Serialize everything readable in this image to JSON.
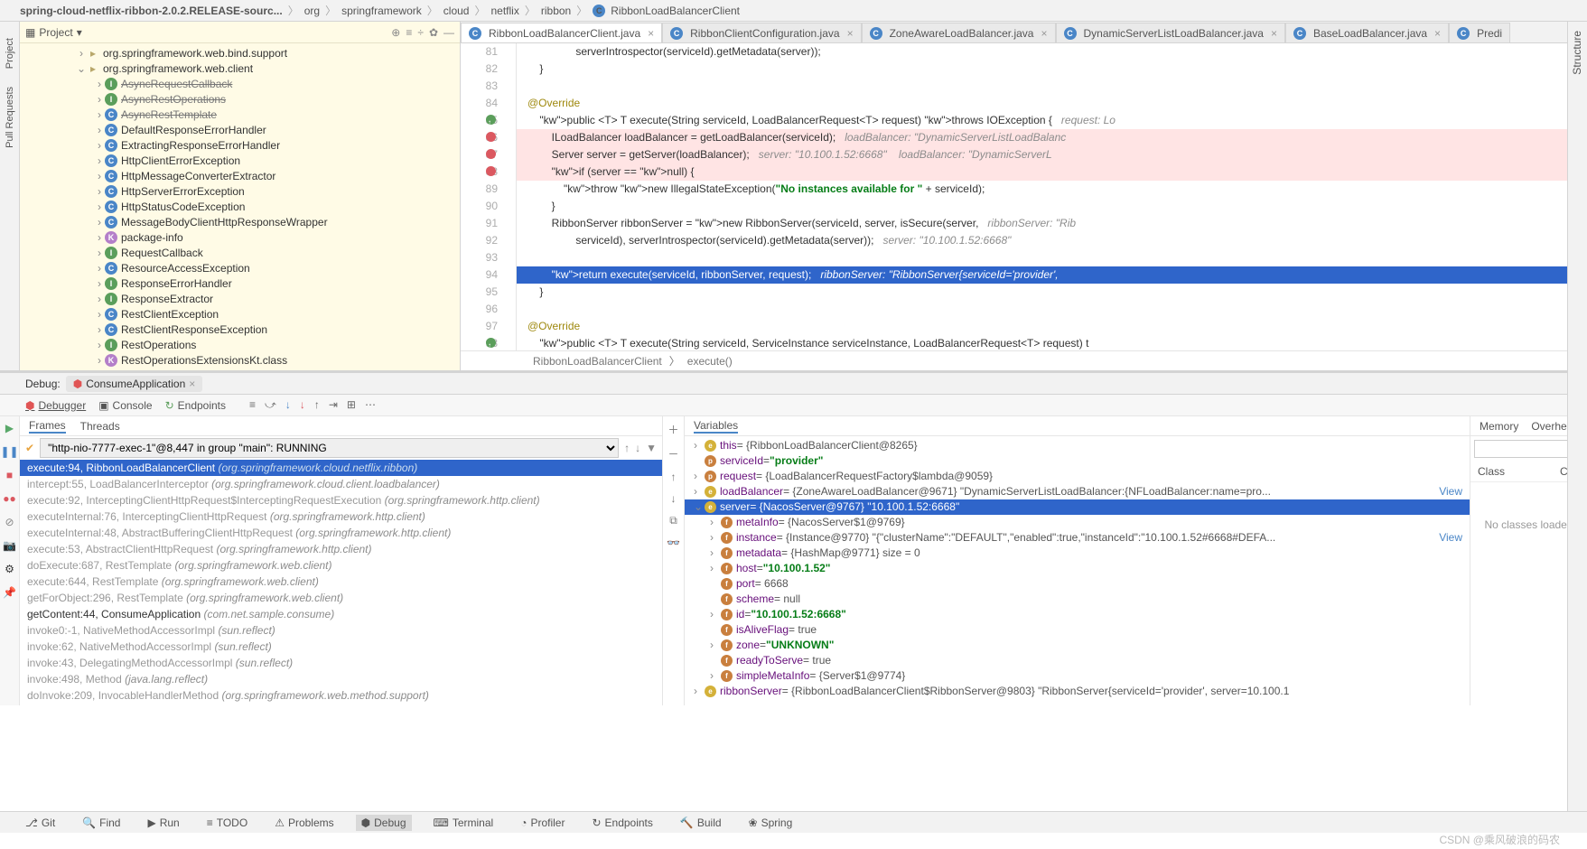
{
  "breadcrumbs": [
    "spring-cloud-netflix-ribbon-2.0.2.RELEASE-sourc...",
    "org",
    "springframework",
    "cloud",
    "netflix",
    "ribbon",
    "RibbonLoadBalancerClient"
  ],
  "project_label": "Project",
  "tree": {
    "pkg1": "org.springframework.web.bind.support",
    "pkg2": "org.springframework.web.client",
    "items": [
      {
        "t": "I",
        "n": "AsyncRequestCallback",
        "strike": true
      },
      {
        "t": "I",
        "n": "AsyncRestOperations",
        "strike": true
      },
      {
        "t": "C",
        "n": "AsyncRestTemplate",
        "strike": true
      },
      {
        "t": "C",
        "n": "DefaultResponseErrorHandler"
      },
      {
        "t": "C",
        "n": "ExtractingResponseErrorHandler"
      },
      {
        "t": "C",
        "n": "HttpClientErrorException"
      },
      {
        "t": "C",
        "n": "HttpMessageConverterExtractor"
      },
      {
        "t": "C",
        "n": "HttpServerErrorException"
      },
      {
        "t": "C",
        "n": "HttpStatusCodeException"
      },
      {
        "t": "C",
        "n": "MessageBodyClientHttpResponseWrapper"
      },
      {
        "t": "K",
        "n": "package-info"
      },
      {
        "t": "I",
        "n": "RequestCallback"
      },
      {
        "t": "C",
        "n": "ResourceAccessException"
      },
      {
        "t": "I",
        "n": "ResponseErrorHandler"
      },
      {
        "t": "I",
        "n": "ResponseExtractor"
      },
      {
        "t": "C",
        "n": "RestClientException"
      },
      {
        "t": "C",
        "n": "RestClientResponseException"
      },
      {
        "t": "I",
        "n": "RestOperations"
      },
      {
        "t": "K",
        "n": "RestOperationsExtensionsKt.class"
      }
    ]
  },
  "tabs": [
    "RibbonLoadBalancerClient.java",
    "RibbonClientConfiguration.java",
    "ZoneAwareLoadBalancer.java",
    "DynamicServerListLoadBalancer.java",
    "BaseLoadBalancer.java",
    "Predi"
  ],
  "code": {
    "lines": [
      {
        "n": 81,
        "t": "                serverIntrospector(serviceId).getMetadata(server));"
      },
      {
        "n": 82,
        "t": "    }"
      },
      {
        "n": 83,
        "t": ""
      },
      {
        "n": 84,
        "t": "    @Override",
        "ann": true
      },
      {
        "n": 85,
        "t": "    public <T> T execute(String serviceId, LoadBalancerRequest<T> request) throws IOException {",
        "cmt": "   request: Lo",
        "ov": true
      },
      {
        "n": 86,
        "t": "        ILoadBalancer loadBalancer = getLoadBalancer(serviceId);",
        "cmt": "   loadBalancer: \"DynamicServerListLoadBalanc",
        "bp": true,
        "hl": true
      },
      {
        "n": 87,
        "t": "        Server server = getServer(loadBalancer);",
        "cmt": "   server: \"10.100.1.52:6668\"    loadBalancer: \"DynamicServerL",
        "bp": true,
        "hl": true
      },
      {
        "n": 88,
        "t": "        if (server == null) {",
        "bp": true,
        "hl": true
      },
      {
        "n": 89,
        "t": "            throw new IllegalStateException(\"No instances available for \" + serviceId);"
      },
      {
        "n": 90,
        "t": "        }"
      },
      {
        "n": 91,
        "t": "        RibbonServer ribbonServer = new RibbonServer(serviceId, server, isSecure(server,",
        "cmt": "   ribbonServer: \"Rib"
      },
      {
        "n": 92,
        "t": "                serviceId), serverIntrospector(serviceId).getMetadata(server));",
        "cmt": "   server: \"10.100.1.52:6668\""
      },
      {
        "n": 93,
        "t": ""
      },
      {
        "n": 94,
        "t": "        return execute(serviceId, ribbonServer, request);",
        "cmt": "   ribbonServer: \"RibbonServer{serviceId='provider',",
        "cur": true
      },
      {
        "n": 95,
        "t": "    }"
      },
      {
        "n": 96,
        "t": ""
      },
      {
        "n": 97,
        "t": "    @Override",
        "ann": true
      },
      {
        "n": 98,
        "t": "    public <T> T execute(String serviceId, ServiceInstance serviceInstance, LoadBalancerRequest<T> request) t",
        "ov": true
      }
    ]
  },
  "crumb2": {
    "a": "RibbonLoadBalancerClient",
    "b": "execute()"
  },
  "debug": {
    "title": "Debug:",
    "app": "ConsumeApplication",
    "tabs": [
      "Debugger",
      "Console",
      "Endpoints"
    ],
    "subtabs": [
      "Frames",
      "Threads"
    ],
    "thread": "\"http-nio-7777-exec-1\"@8,447 in group \"main\": RUNNING",
    "frames": [
      {
        "m": "execute:94, RibbonLoadBalancerClient",
        "p": "(org.springframework.cloud.netflix.ribbon)",
        "sel": true
      },
      {
        "m": "intercept:55, LoadBalancerInterceptor",
        "p": "(org.springframework.cloud.client.loadbalancer)",
        "dim": true
      },
      {
        "m": "execute:92, InterceptingClientHttpRequest$InterceptingRequestExecution",
        "p": "(org.springframework.http.client)",
        "dim": true
      },
      {
        "m": "executeInternal:76, InterceptingClientHttpRequest",
        "p": "(org.springframework.http.client)",
        "dim": true
      },
      {
        "m": "executeInternal:48, AbstractBufferingClientHttpRequest",
        "p": "(org.springframework.http.client)",
        "dim": true
      },
      {
        "m": "execute:53, AbstractClientHttpRequest",
        "p": "(org.springframework.http.client)",
        "dim": true
      },
      {
        "m": "doExecute:687, RestTemplate",
        "p": "(org.springframework.web.client)",
        "dim": true
      },
      {
        "m": "execute:644, RestTemplate",
        "p": "(org.springframework.web.client)",
        "dim": true
      },
      {
        "m": "getForObject:296, RestTemplate",
        "p": "(org.springframework.web.client)",
        "dim": true
      },
      {
        "m": "getContent:44, ConsumeApplication",
        "p": "(com.net.sample.consume)"
      },
      {
        "m": "invoke0:-1, NativeMethodAccessorImpl",
        "p": "(sun.reflect)",
        "dim": true
      },
      {
        "m": "invoke:62, NativeMethodAccessorImpl",
        "p": "(sun.reflect)",
        "dim": true
      },
      {
        "m": "invoke:43, DelegatingMethodAccessorImpl",
        "p": "(sun.reflect)",
        "dim": true
      },
      {
        "m": "invoke:498, Method",
        "p": "(java.lang.reflect)",
        "dim": true
      },
      {
        "m": "doInvoke:209, InvocableHandlerMethod",
        "p": "(org.springframework.web.method.support)",
        "dim": true
      }
    ],
    "vars": [
      {
        "i": 0,
        "a": ">",
        "b": "e",
        "n": "this",
        "v": " = {RibbonLoadBalancerClient@8265}"
      },
      {
        "i": 0,
        "a": "",
        "b": "p",
        "n": "serviceId",
        "v": " = ",
        "s": "\"provider\""
      },
      {
        "i": 0,
        "a": ">",
        "b": "p",
        "n": "request",
        "v": " = {LoadBalancerRequestFactory$lambda@9059}"
      },
      {
        "i": 0,
        "a": ">",
        "b": "e",
        "n": "loadBalancer",
        "v": " = {ZoneAwareLoadBalancer@9671} \"DynamicServerListLoadBalancer:{NFLoadBalancer:name=pro...",
        "view": "View"
      },
      {
        "i": 0,
        "a": "v",
        "b": "e",
        "n": "server",
        "v": " = {NacosServer@9767} \"10.100.1.52:6668\"",
        "sel": true
      },
      {
        "i": 1,
        "a": ">",
        "b": "f",
        "n": "metaInfo",
        "v": " = {NacosServer$1@9769}"
      },
      {
        "i": 1,
        "a": ">",
        "b": "f",
        "n": "instance",
        "v": " = {Instance@9770} \"{\"clusterName\":\"DEFAULT\",\"enabled\":true,\"instanceId\":\"10.100.1.52#6668#DEFA...",
        "view": "View"
      },
      {
        "i": 1,
        "a": ">",
        "b": "f",
        "n": "metadata",
        "v": " = {HashMap@9771}  size = 0"
      },
      {
        "i": 1,
        "a": ">",
        "b": "f",
        "n": "host",
        "v": " = ",
        "s": "\"10.100.1.52\""
      },
      {
        "i": 1,
        "a": "",
        "b": "f",
        "n": "port",
        "v": " = 6668"
      },
      {
        "i": 1,
        "a": "",
        "b": "f",
        "n": "scheme",
        "v": " = null"
      },
      {
        "i": 1,
        "a": ">",
        "b": "f",
        "n": "id",
        "v": " = ",
        "s": "\"10.100.1.52:6668\""
      },
      {
        "i": 1,
        "a": "",
        "b": "f",
        "n": "isAliveFlag",
        "v": " = true"
      },
      {
        "i": 1,
        "a": ">",
        "b": "f",
        "n": "zone",
        "v": " = ",
        "s": "\"UNKNOWN\""
      },
      {
        "i": 1,
        "a": "",
        "b": "f",
        "n": "readyToServe",
        "v": " = true"
      },
      {
        "i": 1,
        "a": ">",
        "b": "f",
        "n": "simpleMetaInfo",
        "v": " = {Server$1@9774}"
      },
      {
        "i": 0,
        "a": ">",
        "b": "e",
        "n": "ribbonServer",
        "v": " = {RibbonLoadBalancerClient$RibbonServer@9803} \"RibbonServer{serviceId='provider', server=10.100.1"
      }
    ],
    "mem": {
      "tabs": [
        "Memory",
        "Overhead"
      ],
      "ph": "",
      "cols": [
        "Class",
        "Cou"
      ],
      "empty": "No classes loaded"
    }
  },
  "status": [
    "Git",
    "Find",
    "Run",
    "TODO",
    "Problems",
    "Debug",
    "Terminal",
    "Profiler",
    "Endpoints",
    "Build",
    "Spring"
  ],
  "watermark": "CSDN @乘风破浪的码农"
}
